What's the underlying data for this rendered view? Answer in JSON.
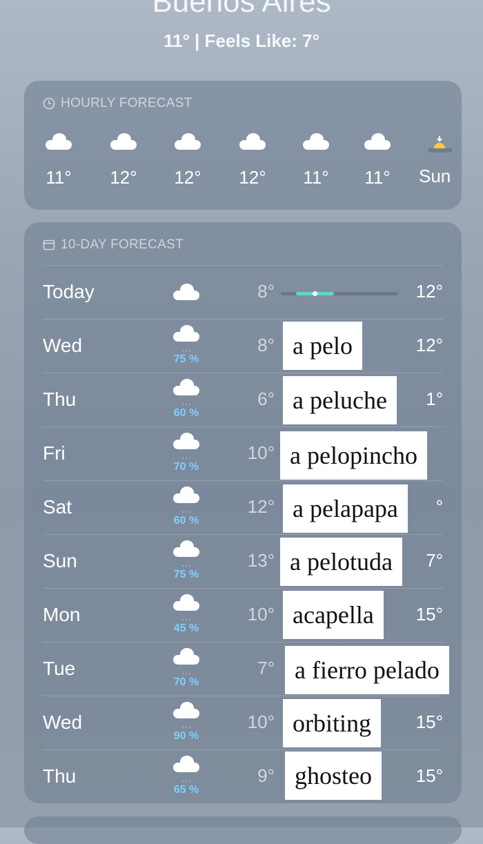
{
  "location": {
    "city": "Buenos Aires",
    "current": "11°  |  Feels Like: 7°"
  },
  "hourly": {
    "header": "HOURLY FORECAST",
    "items": [
      {
        "icon": "cloud-icon",
        "temp": "11°"
      },
      {
        "icon": "cloud-icon",
        "temp": "12°"
      },
      {
        "icon": "cloud-icon",
        "temp": "12°"
      },
      {
        "icon": "cloud-icon",
        "temp": "12°"
      },
      {
        "icon": "cloud-icon",
        "temp": "11°"
      },
      {
        "icon": "cloud-icon",
        "temp": "11°"
      },
      {
        "icon": "sunset-icon",
        "temp": "Sun"
      }
    ]
  },
  "daily": {
    "header": "10-DAY FORECAST",
    "rows": [
      {
        "day": "Today",
        "icon": "cloud-icon",
        "pct": "",
        "low": "8°",
        "high": "12°"
      },
      {
        "day": "Wed",
        "icon": "rain-icon",
        "pct": "75 %",
        "low": "8°",
        "high": "12°"
      },
      {
        "day": "Thu",
        "icon": "rain-icon",
        "pct": "60 %",
        "low": "6°",
        "high": "1°"
      },
      {
        "day": "Fri",
        "icon": "rain-icon",
        "pct": "70 %",
        "low": "10°",
        "high": ""
      },
      {
        "day": "Sat",
        "icon": "rain-icon",
        "pct": "60 %",
        "low": "12°",
        "high": "°"
      },
      {
        "day": "Sun",
        "icon": "rain-icon",
        "pct": "75 %",
        "low": "13°",
        "high": "7°"
      },
      {
        "day": "Mon",
        "icon": "rain-icon",
        "pct": "45 %",
        "low": "10°",
        "high": "15°"
      },
      {
        "day": "Tue",
        "icon": "rain-icon",
        "pct": "70 %",
        "low": "7°",
        "high": ""
      },
      {
        "day": "Wed",
        "icon": "rain-icon",
        "pct": "90 %",
        "low": "10°",
        "high": "15°"
      },
      {
        "day": "Thu",
        "icon": "rain-icon",
        "pct": "65 %",
        "low": "9°",
        "high": "15°"
      }
    ]
  },
  "overlay_labels": [
    "a pelo",
    "a peluche",
    "a pelopincho",
    "a pelapapa",
    "a pelotuda",
    "acapella",
    "a fierro pelado",
    "orbiting",
    "ghosteo"
  ],
  "colors": {
    "rain_pct": "#7fd0ff",
    "bar_fill": "#5fd7d0"
  }
}
